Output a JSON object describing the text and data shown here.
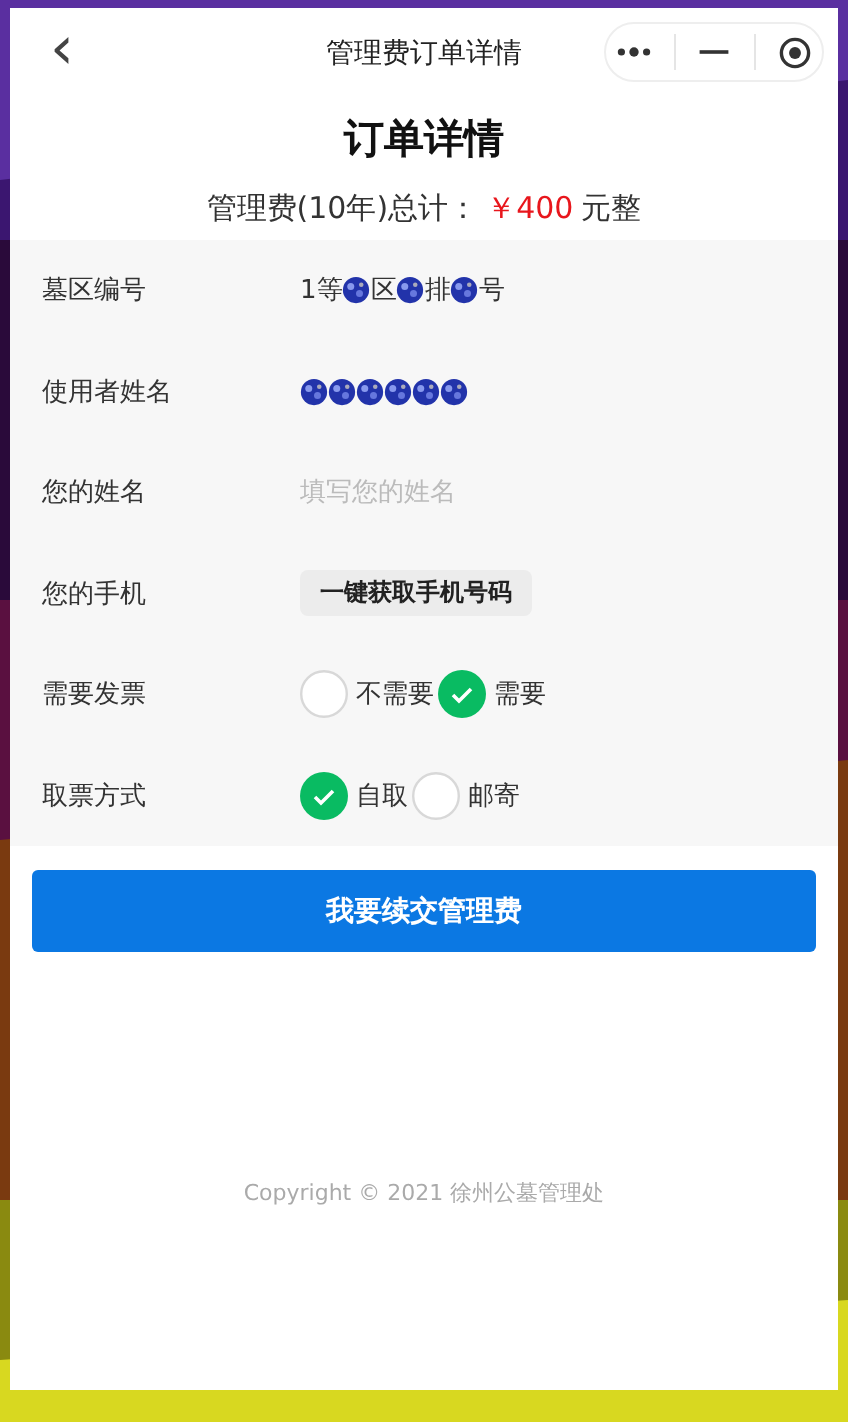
{
  "nav_bar": {
    "back_icon": "‹",
    "title": "管理费订单详情"
  },
  "heading": "订单详情",
  "total": {
    "label": "管理费(10年)总计：",
    "amount": "￥400",
    "suffix": "元整"
  },
  "rows": [
    {
      "kind": "masked",
      "label": "墓区编号",
      "parts": [
        {
          "kind": "text",
          "text": "1等"
        },
        {
          "kind": "redacted"
        },
        {
          "kind": "text",
          "text": "区"
        },
        {
          "kind": "redacted"
        },
        {
          "kind": "text",
          "text": "排"
        },
        {
          "kind": "redacted"
        },
        {
          "kind": "text",
          "text": "号"
        }
      ]
    },
    {
      "kind": "masked",
      "label": "使用者姓名",
      "parts": [
        {
          "kind": "redacted"
        },
        {
          "kind": "redacted"
        },
        {
          "kind": "redacted"
        },
        {
          "kind": "redacted"
        },
        {
          "kind": "redacted"
        },
        {
          "kind": "redacted"
        }
      ]
    },
    {
      "kind": "input",
      "label": "您的姓名",
      "placeholder": "填写您的姓名"
    },
    {
      "kind": "button",
      "label": "您的手机",
      "button": "一键获取手机号码"
    },
    {
      "kind": "radio",
      "label": "需要发票",
      "options": [
        {
          "label": "不需要",
          "selected": false
        },
        {
          "label": "需要",
          "selected": true
        }
      ]
    },
    {
      "kind": "radio",
      "label": "取票方式",
      "options": [
        {
          "label": "自取",
          "selected": true
        },
        {
          "label": "邮寄",
          "selected": false
        }
      ]
    }
  ],
  "submit_button": "我要续交管理费",
  "footer": "Copyright © 2021 徐州公墓管理处"
}
